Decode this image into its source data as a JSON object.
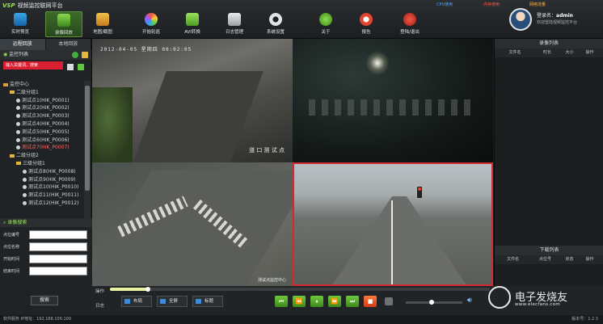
{
  "app": {
    "logo_mark": "VSP",
    "title": "视频监控联网平台"
  },
  "top_status": {
    "cpu": "CPU使用",
    "memory": "内存使用",
    "network": "网络流量"
  },
  "toolbar": [
    {
      "label": "实时预览",
      "icon": "monitor-icon"
    },
    {
      "label": "录像回放",
      "icon": "playback-icon"
    },
    {
      "label": "地图/截图",
      "icon": "map-icon"
    },
    {
      "label": "开始轮巡",
      "icon": "tour-icon"
    },
    {
      "label": "AVI转换",
      "icon": "avi-icon"
    },
    {
      "label": "日志管理",
      "icon": "log-icon"
    },
    {
      "label": "系统设置",
      "icon": "gear-icon"
    },
    {
      "label": "关于",
      "icon": "info-icon"
    },
    {
      "label": "报告",
      "icon": "report-icon"
    },
    {
      "label": "登陆/退出",
      "icon": "power-icon"
    }
  ],
  "user": {
    "label": "登录名：",
    "name": "admin",
    "welcome": "欢迎登陆视频监控平台"
  },
  "left": {
    "tabs": [
      "远程回放",
      "本地回放"
    ],
    "list_title": "监控列表",
    "search_placeholder": "输入关键词，搜索",
    "tree": [
      {
        "label": "监控中心",
        "level": 0,
        "kind": "folder"
      },
      {
        "label": "二级分组1",
        "level": 1,
        "kind": "folder"
      },
      {
        "label": "测试点1(HIK_P0001)",
        "level": 2,
        "kind": "cam"
      },
      {
        "label": "测试点2(HIK_P0002)",
        "level": 2,
        "kind": "cam"
      },
      {
        "label": "测试点3(HIK_P0003)",
        "level": 2,
        "kind": "cam"
      },
      {
        "label": "测试点4(HIK_P0004)",
        "level": 2,
        "kind": "cam"
      },
      {
        "label": "测试点5(HIK_P0005)",
        "level": 2,
        "kind": "cam"
      },
      {
        "label": "测试点6(HIK_P0006)",
        "level": 2,
        "kind": "cam"
      },
      {
        "label": "测试点7(HIK_P0007)",
        "level": 2,
        "kind": "cam",
        "state": "red"
      },
      {
        "label": "二级分组2",
        "level": 1,
        "kind": "folder"
      },
      {
        "label": "三级分组1",
        "level": 2,
        "kind": "folder"
      },
      {
        "label": "测试点8(HIK_P0008)",
        "level": 3,
        "kind": "cam"
      },
      {
        "label": "测试点9(HIK_P0009)",
        "level": 3,
        "kind": "cam"
      },
      {
        "label": "测试点10(HIK_P0010)",
        "level": 3,
        "kind": "cam"
      },
      {
        "label": "测试点11(HIK_P0011)",
        "level": 3,
        "kind": "cam"
      },
      {
        "label": "测试点12(HIK_P0012)",
        "level": 3,
        "kind": "cam"
      }
    ],
    "record_search": {
      "title": "录像搜索",
      "fields": [
        "点位编号",
        "点位名称",
        "开始时间",
        "结束时间"
      ],
      "button": "搜索"
    }
  },
  "videos": [
    {
      "timestamp": "2012-04-05  星期四  00:02:05",
      "caption": "道 口 测 试 点"
    },
    {
      "timestamp": "",
      "caption": ""
    },
    {
      "timestamp": "",
      "caption": "测试点监控中心"
    },
    {
      "timestamp": "",
      "caption": ""
    }
  ],
  "right": {
    "record_list_title": "录像列表",
    "record_cols": [
      "文件名",
      "时长",
      "大小",
      "操作"
    ],
    "download_title": "下载列表",
    "download_cols": [
      "文件名",
      "点位号",
      "状态",
      "操作"
    ]
  },
  "bottom": {
    "progress": 0.1,
    "op_label": "操作",
    "log_label": "日志",
    "layout_buttons": [
      "布局",
      "全屏",
      "标题"
    ],
    "controls": [
      "⏮",
      "⏪",
      "⏸",
      "⏩",
      "⏭",
      "■"
    ],
    "volume": 0.45
  },
  "statusbar": {
    "left": "软件服务  IP地址：192.168.100.100",
    "right": "版本号：1.2.3"
  },
  "watermark": {
    "title": "电子发烧友",
    "url": "www.elecfans.com"
  }
}
